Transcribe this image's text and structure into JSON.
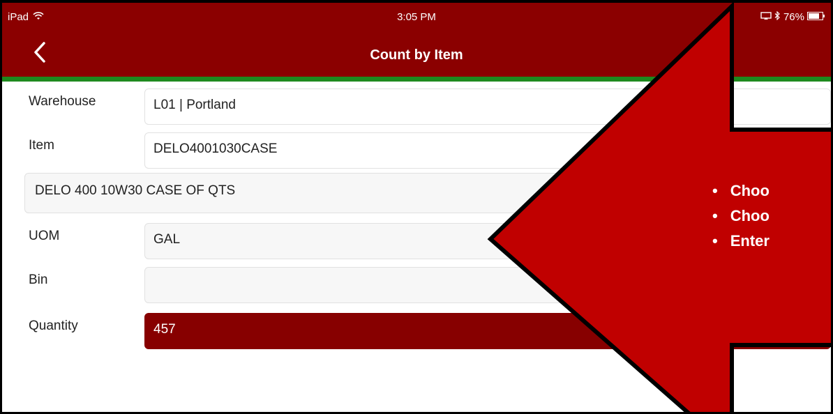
{
  "status_bar": {
    "device": "iPad",
    "time": "3:05 PM",
    "battery_percent": "76%",
    "wifi_icon": "wifi-icon",
    "bluetooth_icon": "bluetooth-icon",
    "battery_icon": "battery-icon"
  },
  "nav": {
    "back_icon": "chevron-left-icon",
    "title": "Count by Item"
  },
  "form": {
    "warehouse": {
      "label": "Warehouse",
      "value": "L01 | Portland"
    },
    "item": {
      "label": "Item",
      "value": "DELO4001030CASE"
    },
    "description": "DELO 400 10W30 CASE OF QTS",
    "uom": {
      "label": "UOM",
      "value": "GAL"
    },
    "bin": {
      "label": "Bin",
      "value": ""
    },
    "quantity": {
      "label": "Quantity",
      "value": "457"
    }
  },
  "callout": {
    "bullets": [
      "Choo",
      "Choo",
      "Enter"
    ]
  },
  "colors": {
    "brand": "#8b0000",
    "accent_line": "#1e8a1e",
    "arrow": "#c00000"
  }
}
